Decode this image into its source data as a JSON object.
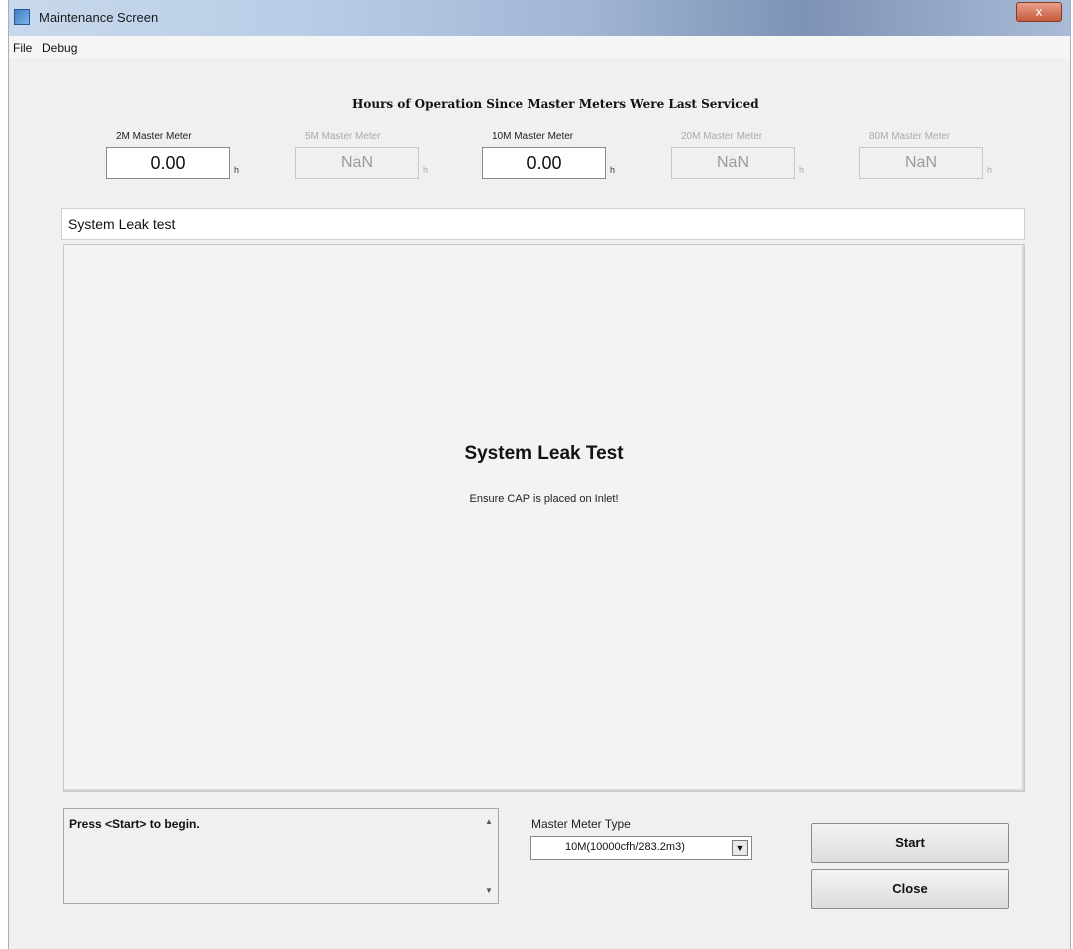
{
  "window": {
    "title": "Maintenance Screen",
    "close_glyph": "x"
  },
  "menu": {
    "file": "File",
    "debug": "Debug"
  },
  "hours": {
    "heading": "Hours of Operation Since Master Meters Were Last Serviced",
    "unit": "h",
    "meters": [
      {
        "label": "2M Master Meter",
        "value": "0.00",
        "enabled": true
      },
      {
        "label": "5M Master Meter",
        "value": "NaN",
        "enabled": false
      },
      {
        "label": "10M Master Meter",
        "value": "0.00",
        "enabled": true
      },
      {
        "label": "20M Master Meter",
        "value": "NaN",
        "enabled": false
      },
      {
        "label": "80M Master Meter",
        "value": "NaN",
        "enabled": false
      }
    ]
  },
  "section_title": "System Leak test",
  "panel": {
    "title": "System Leak Test",
    "subtitle": "Ensure CAP is placed on Inlet!"
  },
  "status": {
    "message": "Press <Start> to begin."
  },
  "master_meter_type": {
    "label": "Master Meter Type",
    "selected": "10M(10000cfh/283.2m3)"
  },
  "buttons": {
    "start": "Start",
    "close": "Close"
  }
}
